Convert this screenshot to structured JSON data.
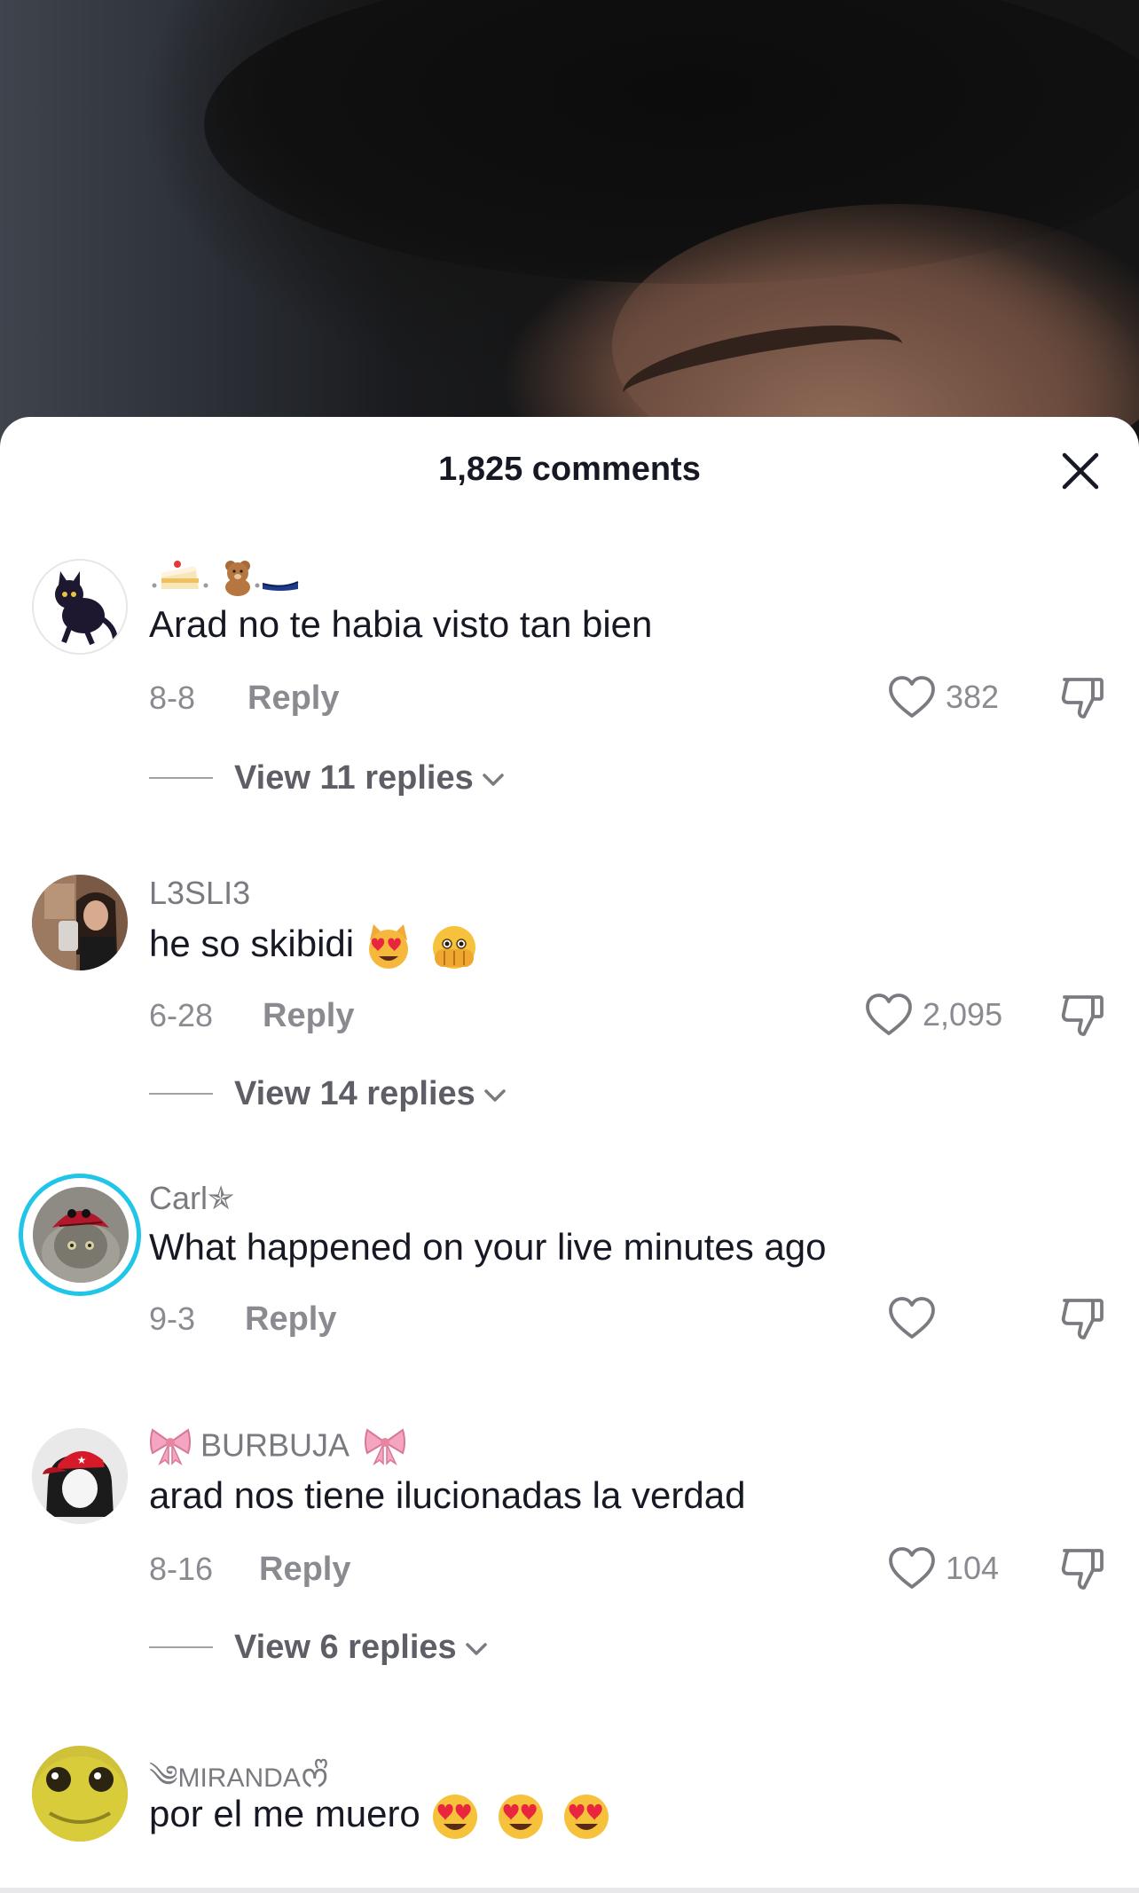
{
  "sheet": {
    "title": "1,825 comments"
  },
  "comments": [
    {
      "username": "",
      "username_emojis": [
        "cake-icon",
        "teddy-bear-icon",
        "shoe-icon"
      ],
      "text": "Arad no te habia visto tan bien",
      "date": "8-8",
      "reply_label": "Reply",
      "likes": "382",
      "view_replies": "View 11 replies",
      "avatar": "black-cat-avatar"
    },
    {
      "username": "L3SLI3",
      "text": "he so skibidi",
      "text_emojis": [
        "heart-eyes-cat-icon",
        "face-peeking-icon"
      ],
      "date": "6-28",
      "reply_label": "Reply",
      "likes": "2,095",
      "view_replies": "View 14 replies",
      "avatar": "selfie-girl-avatar"
    },
    {
      "username": "Carl✯",
      "text": "What happened on your live minutes ago",
      "date": "9-3",
      "reply_label": "Reply",
      "likes": "",
      "avatar": "cat-spider-hat-avatar",
      "has_story_ring": true
    },
    {
      "username": "BURBUJA",
      "username_emojis": [
        "bow-icon",
        "bow-icon"
      ],
      "text": "arad nos tiene ilucionadas la verdad",
      "date": "8-16",
      "reply_label": "Reply",
      "likes": "104",
      "view_replies": "View 6 replies",
      "avatar": "red-cap-avatar"
    },
    {
      "username": "MIRANDA",
      "username_decor_left": "༄",
      "username_decor_right": "ᰔᩚ",
      "text": "por el me muero",
      "text_emojis": [
        "heart-eyes-icon",
        "heart-eyes-icon",
        "heart-eyes-icon"
      ],
      "avatar": "yellow-creature-avatar"
    }
  ],
  "colors": {
    "story_ring": "#20c5e8",
    "text_primary": "#161823",
    "text_secondary": "#8a8b91"
  }
}
